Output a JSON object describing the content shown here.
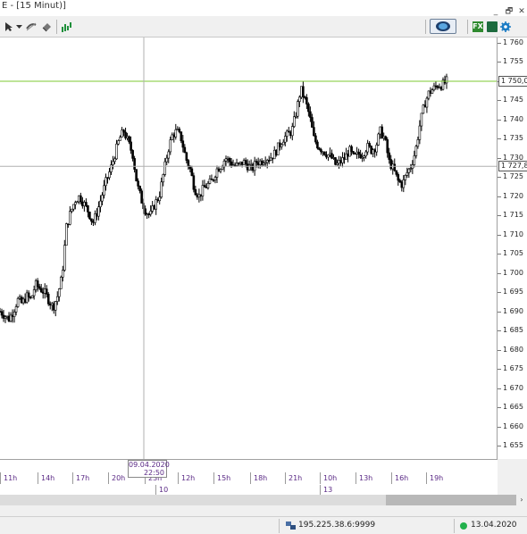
{
  "window": {
    "title": "E - [15 Minut)]",
    "minimize_label": "_",
    "restore_label": "🗗",
    "close_label": "✕"
  },
  "toolbar": {
    "icons": [
      "cursor-icon",
      "dropdown-arrow-icon",
      "link-icon",
      "eraser-icon",
      "bar-chart-icon",
      "globe-button-icon",
      "fx-icon",
      "book-icon",
      "gear-icon"
    ],
    "fx_label": "FX"
  },
  "colors": {
    "horizontal_line": "#7ec832",
    "candle": "#000000",
    "time_label": "#5b2a86",
    "status_ok": "#22b14c"
  },
  "price_axis": {
    "ticks": [
      "1 760",
      "1 755",
      "1 750",
      "1 745",
      "1 740",
      "1 735",
      "1 730",
      "1 725",
      "1 720",
      "1 715",
      "1 710",
      "1 705",
      "1 700",
      "1 695",
      "1 690",
      "1 685",
      "1 680",
      "1 675",
      "1 670",
      "1 665",
      "1 660",
      "1 655"
    ],
    "horizontal_line_label": "1 750,0",
    "crosshair_label": "1 727,8"
  },
  "time_axis": {
    "hours": [
      "11h",
      "14h",
      "17h",
      "20h",
      "23h",
      "12h",
      "15h",
      "18h",
      "21h",
      "10h",
      "13h",
      "16h",
      "19h"
    ],
    "days": [
      "10",
      "13"
    ],
    "crosshair_date": "09.04.2020",
    "crosshair_time": "22:50"
  },
  "chart_data": {
    "type": "candlestick",
    "timeframe": "15 min",
    "ylim": [
      1651,
      1762
    ],
    "horizontal_line": 1750.0,
    "crosshair_price": 1727.8,
    "close_series": [
      1690,
      1689,
      1688,
      1690,
      1693,
      1692,
      1694,
      1693,
      1697,
      1696,
      1695,
      1693,
      1691,
      1694,
      1699,
      1712,
      1716,
      1719,
      1720,
      1718,
      1716,
      1713,
      1716,
      1720,
      1724,
      1727,
      1731,
      1735,
      1737,
      1734,
      1731,
      1723,
      1719,
      1716,
      1715,
      1718,
      1720,
      1726,
      1732,
      1736,
      1737,
      1735,
      1730,
      1727,
      1722,
      1720,
      1722,
      1723,
      1724,
      1727,
      1728,
      1730,
      1729,
      1728,
      1728,
      1729,
      1728,
      1727,
      1729,
      1729,
      1730,
      1730,
      1731,
      1733,
      1735,
      1736,
      1737,
      1742,
      1748,
      1745,
      1741,
      1735,
      1733,
      1732,
      1731,
      1730,
      1728,
      1729,
      1730,
      1732,
      1730,
      1731,
      1731,
      1733,
      1732,
      1733,
      1737,
      1735,
      1729,
      1727,
      1724,
      1723,
      1726,
      1728,
      1732,
      1739,
      1744,
      1747,
      1748,
      1749,
      1749,
      1750
    ],
    "title": ""
  },
  "status_bar": {
    "server": "195.225.38.6:9999",
    "date": "13.04.2020"
  }
}
